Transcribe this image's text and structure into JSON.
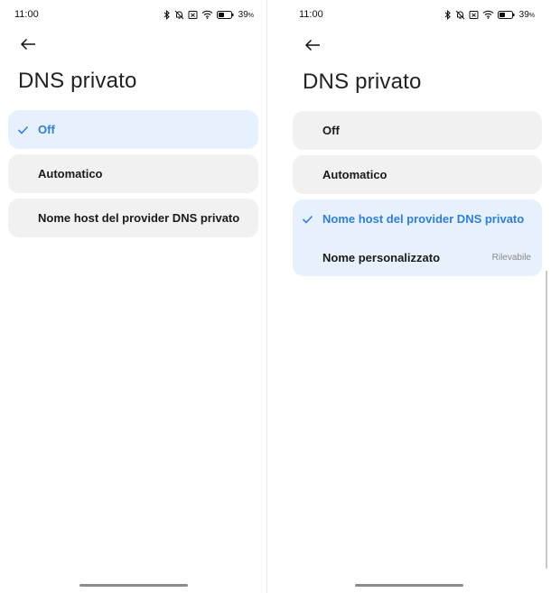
{
  "screens": [
    {
      "status": {
        "time": "11:00",
        "battery": "39",
        "battery_unit": "%"
      },
      "title": "DNS privato",
      "options": [
        {
          "label": "Off",
          "selected": true
        },
        {
          "label": "Automatico",
          "selected": false
        },
        {
          "label": "Nome host del provider DNS privato",
          "selected": false
        }
      ]
    },
    {
      "status": {
        "time": "11:00",
        "battery": "39",
        "battery_unit": "%"
      },
      "title": "DNS privato",
      "options": [
        {
          "label": "Off",
          "selected": false
        },
        {
          "label": "Automatico",
          "selected": false
        },
        {
          "label": "Nome host del provider DNS privato",
          "selected": true
        }
      ],
      "custom_name": {
        "label": "Nome personalizzato",
        "hint": "Rilevabile"
      }
    }
  ],
  "colors": {
    "accent": "#2f7fe1",
    "selected_bg": "#e7f1fe",
    "option_bg": "#f1f1f1",
    "background": "#ffffff"
  },
  "icons": {
    "back": "arrow-left-icon",
    "check": "checkmark-icon",
    "bluetooth": "bluetooth-icon",
    "mute": "bell-off-icon",
    "sim": "no-sim-icon",
    "wifi": "wifi-icon",
    "battery": "battery-icon"
  }
}
